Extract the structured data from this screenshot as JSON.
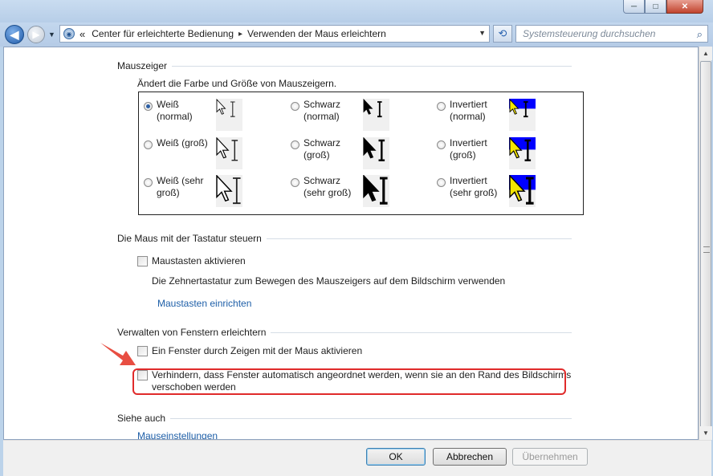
{
  "window": {
    "minimize": "─",
    "maximize": "□",
    "close": "✕"
  },
  "nav": {
    "back_icon": "◀",
    "forward_icon": "▶",
    "history_icon": "▼"
  },
  "address": {
    "prefix": "«",
    "crumbs": [
      "Center für erleichterte Bedienung",
      "Verwenden der Maus erleichtern"
    ],
    "crumb_sep": "▸"
  },
  "search": {
    "placeholder": "Systemsteuerung durchsuchen",
    "icon": "⌕"
  },
  "mauszeiger": {
    "group_label": "Mauszeiger",
    "description": "Ändert die Farbe und Größe von Mauszeigern.",
    "options": [
      {
        "line1": "Weiß",
        "line2": "(normal)",
        "selected": true,
        "scheme": "white",
        "size": "normal"
      },
      {
        "line1": "Schwarz",
        "line2": "(normal)",
        "selected": false,
        "scheme": "black",
        "size": "normal"
      },
      {
        "line1": "Invertiert",
        "line2": "(normal)",
        "selected": false,
        "scheme": "inverted",
        "size": "normal"
      },
      {
        "line1": "Weiß (groß)",
        "line2": "",
        "selected": false,
        "scheme": "white",
        "size": "large"
      },
      {
        "line1": "Schwarz",
        "line2": "(groß)",
        "selected": false,
        "scheme": "black",
        "size": "large"
      },
      {
        "line1": "Invertiert",
        "line2": "(groß)",
        "selected": false,
        "scheme": "inverted",
        "size": "large"
      },
      {
        "line1": "Weiß (sehr",
        "line2": "groß)",
        "selected": false,
        "scheme": "white",
        "size": "xlarge"
      },
      {
        "line1": "Schwarz",
        "line2": "(sehr groß)",
        "selected": false,
        "scheme": "black",
        "size": "xlarge"
      },
      {
        "line1": "Invertiert",
        "line2": "(sehr groß)",
        "selected": false,
        "scheme": "inverted",
        "size": "xlarge"
      }
    ]
  },
  "tastatur": {
    "group_label": "Die Maus mit der Tastatur steuern",
    "checkbox_label": "Maustasten aktivieren",
    "description": "Die Zehnertastatur zum Bewegen des Mauszeigers auf dem Bildschirm verwenden",
    "link": "Maustasten einrichten"
  },
  "fenster": {
    "group_label": "Verwalten von Fenstern erleichtern",
    "checkbox1": "Ein Fenster durch Zeigen mit der Maus aktivieren",
    "checkbox2_line1": "Verhindern, dass Fenster automatisch angeordnet werden, wenn sie an den Rand des Bildschirms",
    "checkbox2_line2": "verschoben werden"
  },
  "siehe_auch": {
    "group_label": "Siehe auch",
    "link": "Mauseinstellungen"
  },
  "buttons": {
    "ok": "OK",
    "cancel": "Abbrechen",
    "apply": "Übernehmen"
  },
  "colors": {
    "accent": "#1e5fa8",
    "highlight": "#e02b2b",
    "inverted_bg": "#0000ff"
  }
}
